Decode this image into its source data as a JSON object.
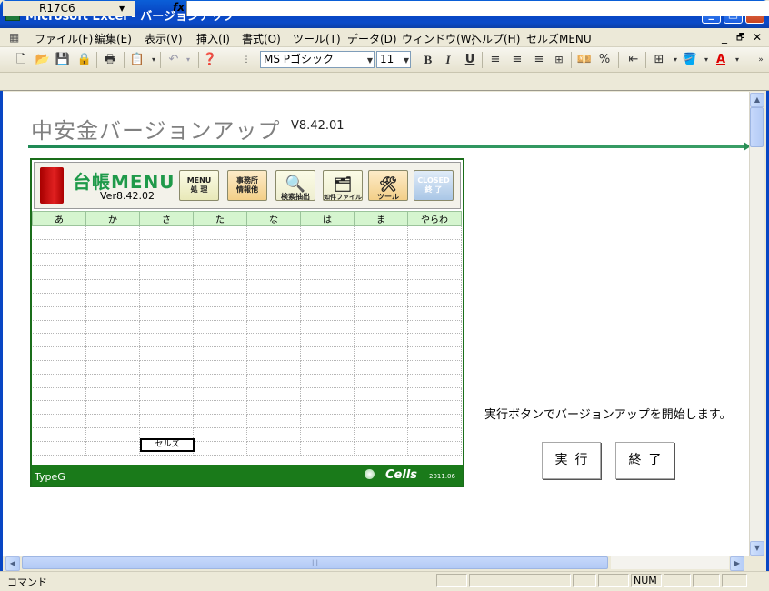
{
  "window": {
    "title": "Microsoft Excel - バージョンアップ",
    "app_icon_glyph": "X",
    "minimize_glyph": "_",
    "maximize_glyph": "□",
    "close_glyph": "✕"
  },
  "menubar": {
    "items": [
      "ファイル(F)",
      "編集(E)",
      "表示(V)",
      "挿入(I)",
      "書式(O)",
      "ツール(T)",
      "データ(D)",
      "ウィンドウ(W)",
      "ヘルプ(H)",
      "セルズMENU"
    ],
    "doc_min": "_",
    "doc_restore": "🗗",
    "doc_close": "✕"
  },
  "toolbar": {
    "font_name": "MS Pゴシック",
    "font_size": "11",
    "bold": "B",
    "italic": "I",
    "underline": "U",
    "percent": "%"
  },
  "formulabar": {
    "name_box": "R17C6",
    "fx": "fx"
  },
  "sheet": {
    "title": "中安金バージョンアップ",
    "version": "V8.42.01",
    "panel": {
      "title": "台帳MENU",
      "version": "Ver8.42.02",
      "buttons": {
        "menu": "MENU\n処 理",
        "office": "事務所\n情報他",
        "search": "検索抽出",
        "file": "如件ファイル",
        "tool": "ツール",
        "closed": "CLOSED\n終 了"
      },
      "kana_headers": [
        "あ",
        "か",
        "さ",
        "た",
        "な",
        "は",
        "ま",
        "やらわ"
      ],
      "cell_label": "セルズ",
      "footer_type": "TypeG",
      "footer_logo": "Cells",
      "footer_date": "2011.06"
    },
    "info_text": "実行ボタンでバージョンアップを開始します。",
    "run_button": "実行",
    "end_button": "終了"
  },
  "statusbar": {
    "text": "コマンド",
    "num": "NUM"
  },
  "colors": {
    "titlebar": "#0846c4",
    "panel_green": "#1a7a1a",
    "kana_header_bg": "#d5f5cf",
    "title_line": "#1f8a55"
  }
}
